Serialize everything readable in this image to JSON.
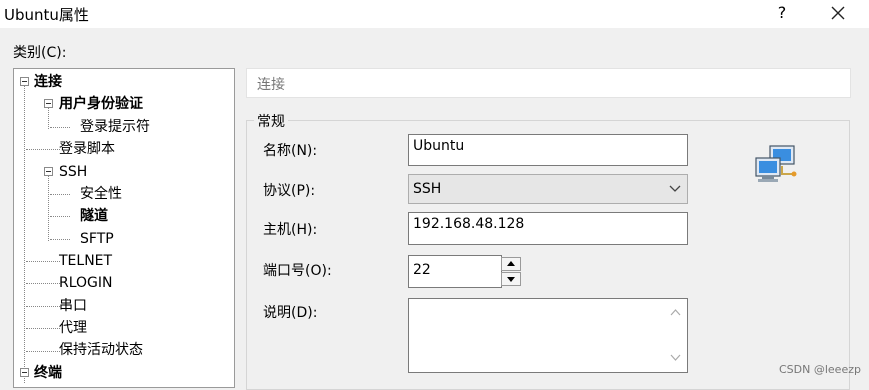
{
  "window": {
    "title": "Ubuntu属性",
    "help_symbol": "?"
  },
  "category_label": "类别(C):",
  "tree": {
    "items": [
      {
        "label": "连接",
        "bold": true,
        "expanded": true
      },
      {
        "label": "用户身份验证",
        "bold": true,
        "expanded": true
      },
      {
        "label": "登录提示符",
        "bold": false
      },
      {
        "label": "登录脚本",
        "bold": false
      },
      {
        "label": "SSH",
        "bold": false,
        "expanded": true
      },
      {
        "label": "安全性",
        "bold": false
      },
      {
        "label": "隧道",
        "bold": true
      },
      {
        "label": "SFTP",
        "bold": false
      },
      {
        "label": "TELNET",
        "bold": false
      },
      {
        "label": "RLOGIN",
        "bold": false
      },
      {
        "label": "串口",
        "bold": false
      },
      {
        "label": "代理",
        "bold": false
      },
      {
        "label": "保持活动状态",
        "bold": false
      },
      {
        "label": "终端",
        "bold": true,
        "expanded": true
      }
    ]
  },
  "panel": {
    "header": "连接",
    "group_title": "常规",
    "fields": {
      "name": {
        "label": "名称(N):",
        "value": "Ubuntu"
      },
      "protocol": {
        "label": "协议(P):",
        "value": "SSH"
      },
      "host": {
        "label": "主机(H):",
        "value": "192.168.48.128"
      },
      "port": {
        "label": "端口号(O):",
        "value": "22"
      },
      "description": {
        "label": "说明(D):",
        "value": ""
      }
    }
  },
  "watermark": "CSDN @leeezp",
  "icons": {
    "help": "question-icon",
    "close": "close-icon",
    "network": "network-computers-icon",
    "dropdown": "chevron-down-icon"
  }
}
